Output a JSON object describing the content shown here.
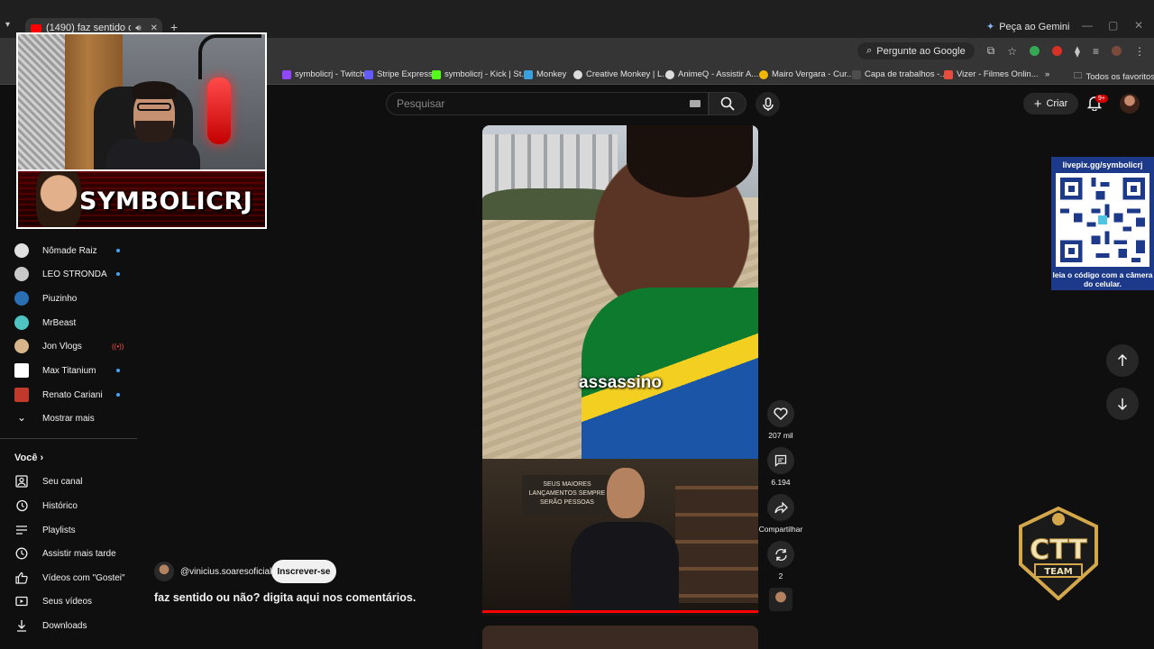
{
  "browser": {
    "tab_title": "(1490) faz sentido ou não?",
    "new_tab_symbol": "+",
    "gemini_label": "Peça ao Gemini",
    "ask_google_label": "Pergunte ao Google",
    "bookmarks": [
      {
        "label": "symbolicrj - Twitch",
        "color": "#9146ff"
      },
      {
        "label": "Stripe Express",
        "color": "#635bff"
      },
      {
        "label": "symbolicrj - Kick | St...",
        "color": "#53fc18"
      },
      {
        "label": "Monkey",
        "color": "#3aa0e0"
      },
      {
        "label": "Creative Monkey | L...",
        "color": "#dddddd"
      },
      {
        "label": "AnimeQ - Assistir A...",
        "color": "#dddddd"
      },
      {
        "label": "Mairo Vergara - Cur...",
        "color": "#f2b705"
      },
      {
        "label": "Capa de trabalhos -...",
        "color": "#4d4d4d"
      },
      {
        "label": "Vizer - Filmes Onlin...",
        "color": "#e74c3c"
      }
    ],
    "all_bookmarks_label": "Todos os favoritos"
  },
  "masthead": {
    "search_placeholder": "Pesquisar",
    "create_label": "Criar",
    "notifications_badge": "9+"
  },
  "sidebar": {
    "subscriptions": [
      {
        "label": "Nômade Raiz",
        "status": "new",
        "avatar_color": "#e0e0e0"
      },
      {
        "label": "LEO STRONDA",
        "status": "new",
        "avatar_color": "#c9c9c9"
      },
      {
        "label": "Piuzinho",
        "status": "none",
        "avatar_color": "#2a6fb3"
      },
      {
        "label": "MrBeast",
        "status": "none",
        "avatar_color": "#4fc3c3"
      },
      {
        "label": "Jon Vlogs",
        "status": "live",
        "avatar_color": "#d7b48a"
      },
      {
        "label": "Max Titanium",
        "status": "new",
        "avatar_color": "#ffffff"
      },
      {
        "label": "Renato Cariani",
        "status": "new",
        "avatar_color": "#c0392b"
      }
    ],
    "show_more": "Mostrar mais",
    "you_header": "Você",
    "you_items": [
      {
        "label": "Seu canal",
        "icon": "user-box-icon"
      },
      {
        "label": "Histórico",
        "icon": "history-icon"
      },
      {
        "label": "Playlists",
        "icon": "playlist-icon"
      },
      {
        "label": "Assistir mais tarde",
        "icon": "clock-icon"
      },
      {
        "label": "Vídeos com \"Gostei\"",
        "icon": "thumbs-up-icon"
      },
      {
        "label": "Seus vídeos",
        "icon": "video-icon"
      },
      {
        "label": "Downloads",
        "icon": "download-icon"
      }
    ]
  },
  "overlay": {
    "streamer_name": "SYMBOLICRJ",
    "qr_url": "livepix.gg/symbolicrj",
    "qr_note": "leia o código com a câmera do celular.",
    "team_label": "CTT",
    "team_sub": "TEAM"
  },
  "short": {
    "caption": "assassino",
    "poster_text": "SEUS MAIORES LANÇAMENTOS SEMPRE SERÃO PESSOAS",
    "channel": "@vinicius.soaresoficial",
    "subscribe_label": "Inscrever-se",
    "title": "faz sentido ou não? digita aqui nos comentários.",
    "likes": "207 mil",
    "comments": "6.194",
    "share_label": "Compartilhar",
    "remix_count": "2",
    "progress": 1.0
  }
}
